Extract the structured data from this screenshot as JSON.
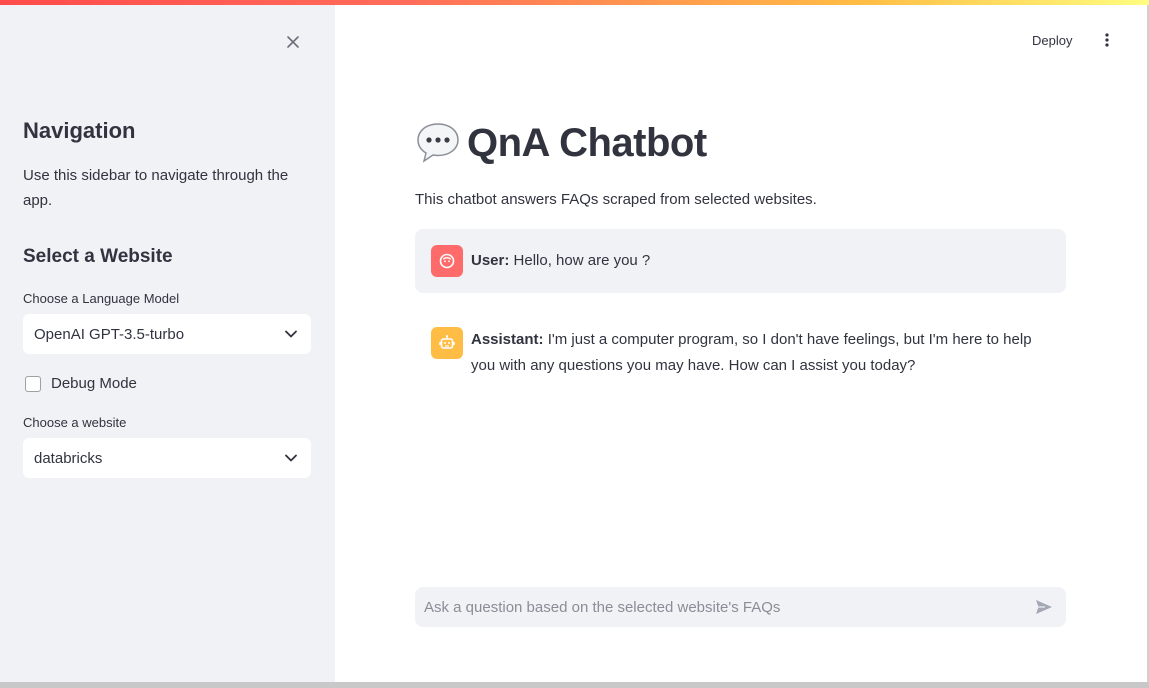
{
  "sidebar": {
    "title": "Navigation",
    "description": "Use this sidebar to navigate through the app.",
    "subtitle": "Select a Website",
    "model_label": "Choose a Language Model",
    "model_value": "OpenAI GPT-3.5-turbo",
    "debug_label": "Debug Mode",
    "debug_checked": false,
    "website_label": "Choose a website",
    "website_value": "databricks"
  },
  "toolbar": {
    "deploy_label": "Deploy"
  },
  "main": {
    "title": "QnA Chatbot",
    "caption": "This chatbot answers FAQs scraped from selected websites."
  },
  "messages": [
    {
      "role": "User:",
      "text": "Hello, how are you ?"
    },
    {
      "role": "Assistant:",
      "text": "I'm just a computer program, so I don't have feelings, but I'm here to help you with any questions you may have. How can I assist you today?"
    }
  ],
  "chat_input": {
    "placeholder": "Ask a question based on the selected website's FAQs"
  },
  "colors": {
    "accent": "#ff4b4b",
    "sidebar_bg": "#f0f2f6",
    "user_avatar": "#ff6b6b",
    "bot_avatar": "#ffbd45"
  },
  "icons": {
    "close": "close-icon",
    "kebab": "more-vertical-icon",
    "title": "speech-bubble-icon",
    "user_avatar": "user-face-icon",
    "bot_avatar": "robot-face-icon",
    "send": "send-icon",
    "chevron": "chevron-down-icon"
  }
}
